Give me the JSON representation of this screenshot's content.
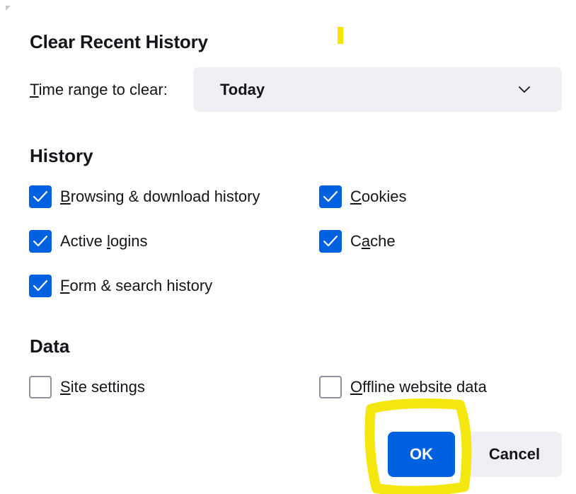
{
  "dialog": {
    "title": "Clear Recent History",
    "time_range": {
      "label_key": "T",
      "label_rest": "ime range to clear:",
      "selected": "Today"
    }
  },
  "history": {
    "heading": "History",
    "options": [
      {
        "key": "B",
        "rest": "rowsing & download history",
        "checked": true
      },
      {
        "key": "C",
        "rest": "ookies",
        "checked": true
      },
      {
        "pre": "Active ",
        "key": "l",
        "rest": "ogins",
        "checked": true
      },
      {
        "pre": "C",
        "key": "a",
        "rest": "che",
        "checked": true
      },
      {
        "key": "F",
        "rest": "orm & search history",
        "checked": true
      }
    ]
  },
  "data": {
    "heading": "Data",
    "options": [
      {
        "key": "S",
        "rest": "ite settings",
        "checked": false
      },
      {
        "key": "O",
        "rest": "ffline website data",
        "checked": false
      }
    ]
  },
  "buttons": {
    "ok": "OK",
    "cancel": "Cancel"
  },
  "colors": {
    "accent": "#0061e0",
    "highlight": "#f2e600"
  },
  "icons": {
    "checkmark": "checkmark-icon",
    "chevron": "chevron-down-icon"
  }
}
